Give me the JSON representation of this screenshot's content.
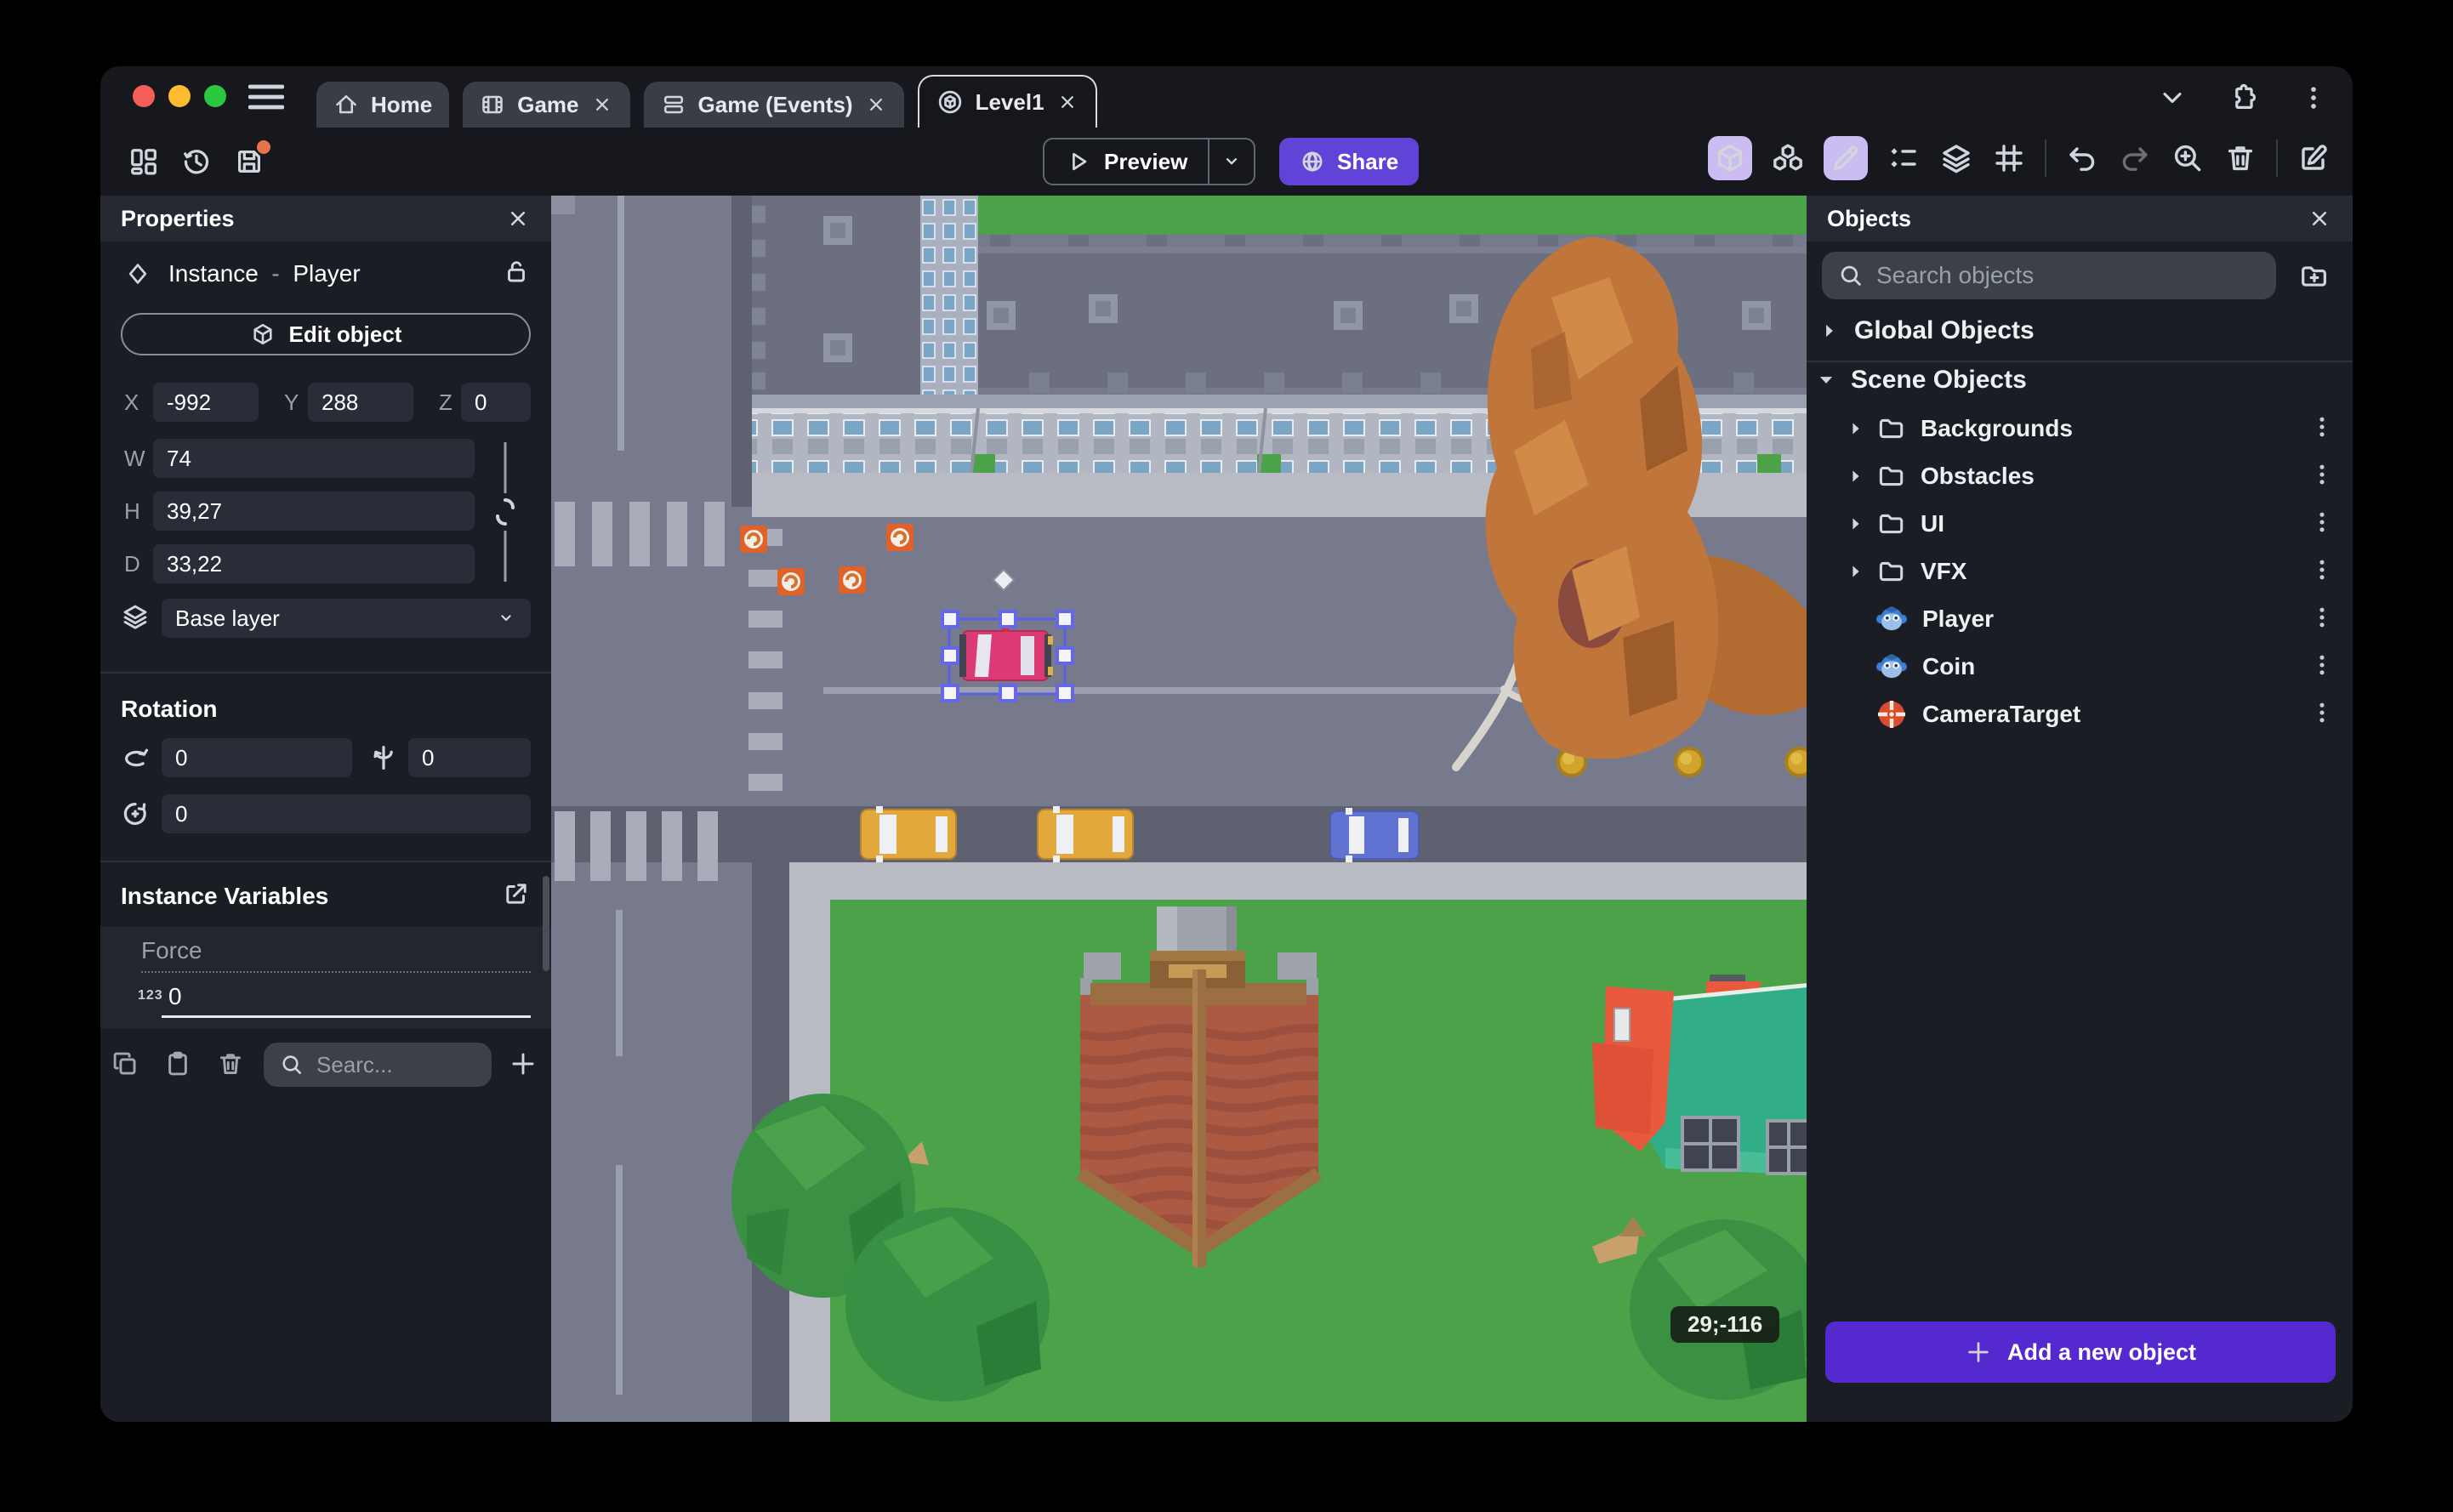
{
  "titlebar": {
    "tabs": [
      {
        "label": "Home"
      },
      {
        "label": "Game"
      },
      {
        "label": "Game (Events)"
      },
      {
        "label": "Level1"
      }
    ]
  },
  "toolbar": {
    "preview": "Preview",
    "share": "Share"
  },
  "properties": {
    "title": "Properties",
    "instance_type": "Instance",
    "instance_sep": "-",
    "instance_name": "Player",
    "edit_object": "Edit object",
    "x_label": "X",
    "x": "-992",
    "y_label": "Y",
    "y": "288",
    "z_label": "Z",
    "z": "0",
    "w_label": "W",
    "w": "74",
    "h_label": "H",
    "h": "39,27",
    "d_label": "D",
    "d": "33,22",
    "layer": "Base layer",
    "rotation_title": "Rotation",
    "rx": "0",
    "ry": "0",
    "rz": "0",
    "variables_title": "Instance Variables",
    "var_name": "Force",
    "var_type": "123",
    "var_value": "0",
    "search_placeholder": "Searc..."
  },
  "objects": {
    "title": "Objects",
    "search_placeholder": "Search objects",
    "global_group": "Global Objects",
    "scene_group": "Scene Objects",
    "folders": [
      "Backgrounds",
      "Obstacles",
      "UI",
      "VFX"
    ],
    "items": [
      "Player",
      "Coin",
      "CameraTarget"
    ],
    "add_button": "Add a new object"
  },
  "canvas": {
    "badge": "29;-116",
    "selected_object": "Player",
    "colors": {
      "grass": "#4ba249",
      "road": "#767a8c",
      "road_dark": "#5d6170",
      "sidewalk": "#b8bac4",
      "selection": "#5a5fe8",
      "player_car": "#dc3a74"
    }
  }
}
